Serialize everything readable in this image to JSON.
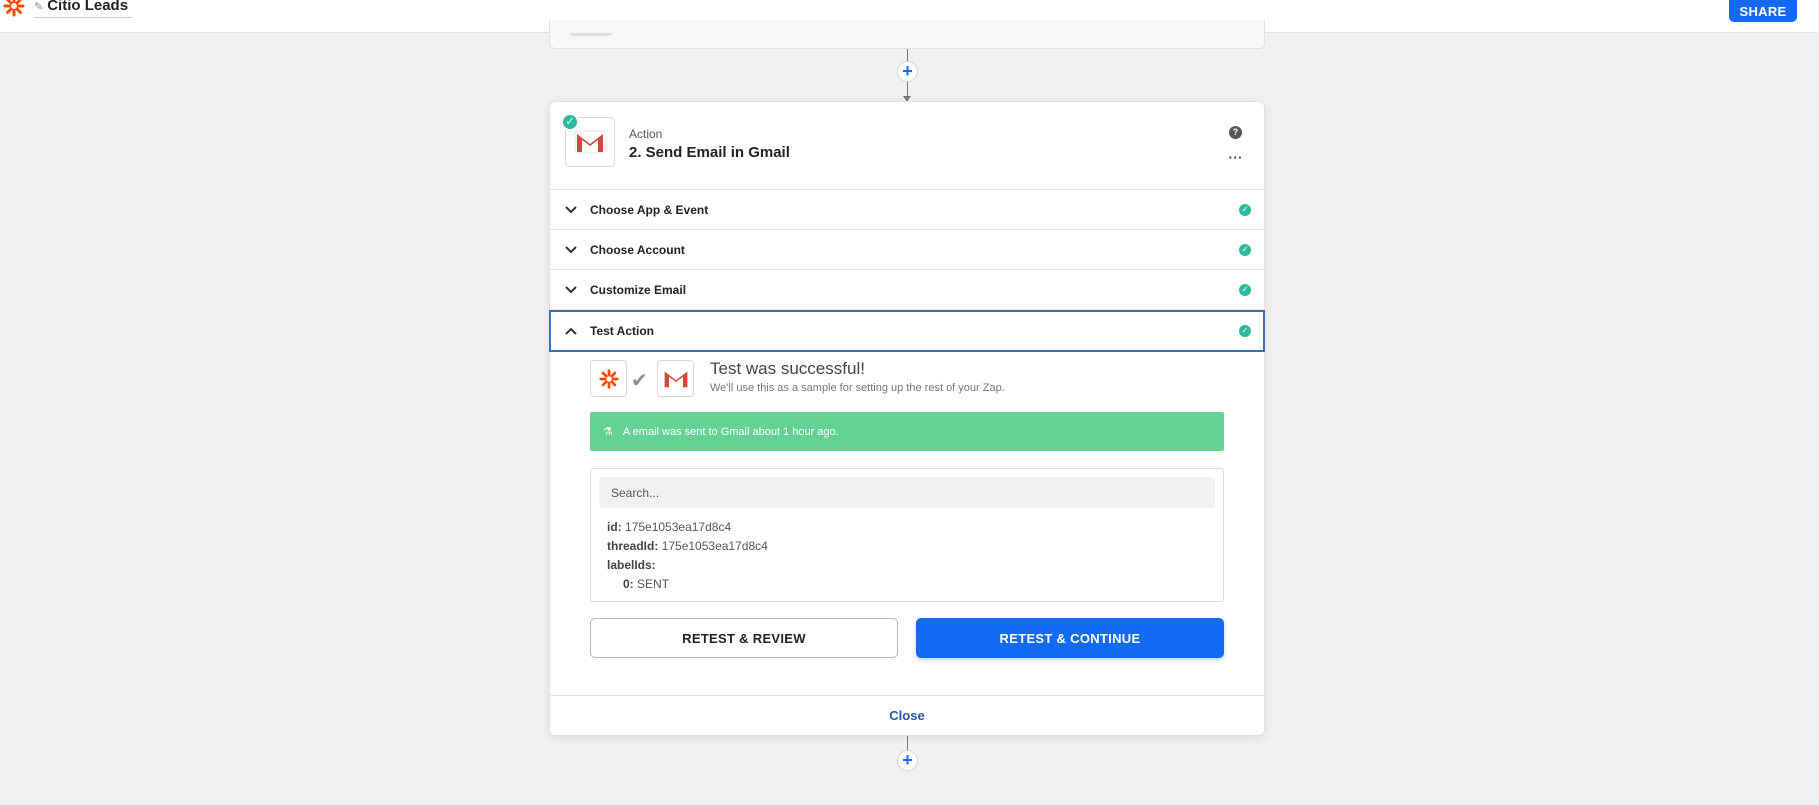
{
  "topbar": {
    "zap_title": "Citio Leads",
    "share_label": "SHARE"
  },
  "step": {
    "type": "Action",
    "title": "2. Send Email in Gmail",
    "help_icon": "question-icon",
    "more_icon": "ellipsis-icon"
  },
  "sections": [
    {
      "label": "Choose App & Event",
      "status": "complete"
    },
    {
      "label": "Choose Account",
      "status": "complete"
    },
    {
      "label": "Customize Email",
      "status": "complete"
    },
    {
      "label": "Test Action",
      "status": "complete"
    }
  ],
  "test": {
    "title": "Test was successful!",
    "subtitle": "We'll use this as a sample for setting up the rest of your Zap.",
    "banner": "A email was sent to Gmail about 1 hour ago.",
    "search_placeholder": "Search...",
    "fields": [
      {
        "key": "id:",
        "value": "175e1053ea17d8c4"
      },
      {
        "key": "threadId:",
        "value": "175e1053ea17d8c4"
      },
      {
        "key": "labelIds:",
        "value": ""
      },
      {
        "key": "0:",
        "value": "SENT"
      }
    ],
    "retest_review_label": "RETEST & REVIEW",
    "retest_continue_label": "RETEST & CONTINUE"
  },
  "footer": {
    "close_label": "Close"
  },
  "colors": {
    "primary": "#136bf5",
    "success": "#2fbb9b",
    "banner": "#64d293",
    "zapier_orange": "#ff4a00",
    "gmail_red": "#d44638"
  }
}
